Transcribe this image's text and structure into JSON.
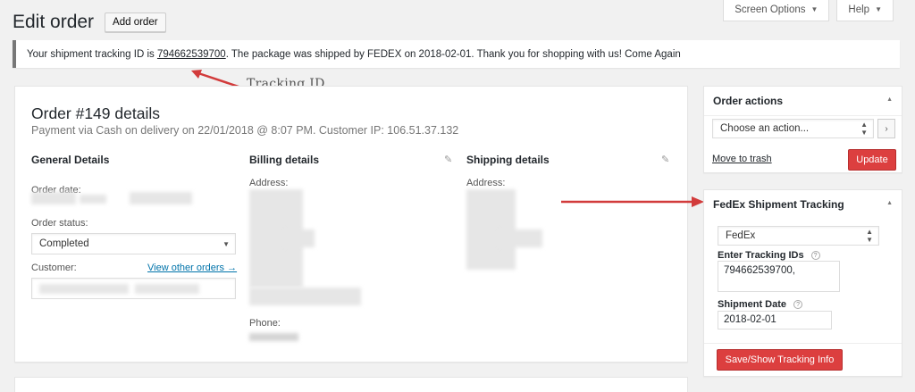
{
  "header": {
    "title": "Edit order",
    "add_button": "Add order"
  },
  "screen_meta": {
    "screen_options": "Screen Options",
    "help": "Help"
  },
  "notice": {
    "prefix": "Your shipment tracking ID is ",
    "tracking_id": "794662539700",
    "suffix": ". The package was shipped by FEDEX on 2018-02-01. Thank you for shopping with us! Come Again"
  },
  "annotations": {
    "tracking_id_label": "Tracking ID"
  },
  "order": {
    "title": "Order #149 details",
    "subtitle": "Payment via Cash on delivery on 22/01/2018 @ 8:07 PM. Customer IP: 106.51.37.132",
    "general": {
      "heading": "General Details",
      "order_date_label": "Order date:",
      "order_status_label": "Order status:",
      "order_status_value": "Completed",
      "customer_label": "Customer:",
      "view_other_orders": "View other orders →"
    },
    "billing": {
      "heading": "Billing details",
      "address_label": "Address:",
      "phone_label": "Phone:"
    },
    "shipping": {
      "heading": "Shipping details",
      "address_label": "Address:"
    }
  },
  "order_actions": {
    "title": "Order actions",
    "select_value": "Choose an action...",
    "move_to_trash": "Move to trash",
    "update_button": "Update"
  },
  "fedex": {
    "title": "FedEx Shipment Tracking",
    "carrier_value": "FedEx",
    "tracking_ids_label": "Enter Tracking IDs",
    "tracking_ids_value": "794662539700,",
    "shipment_date_label": "Shipment Date",
    "shipment_date_value": "2018-02-01",
    "save_button": "Save/Show Tracking Info"
  },
  "colors": {
    "accent_red": "#dc3f3f",
    "link_blue": "#0073aa"
  }
}
